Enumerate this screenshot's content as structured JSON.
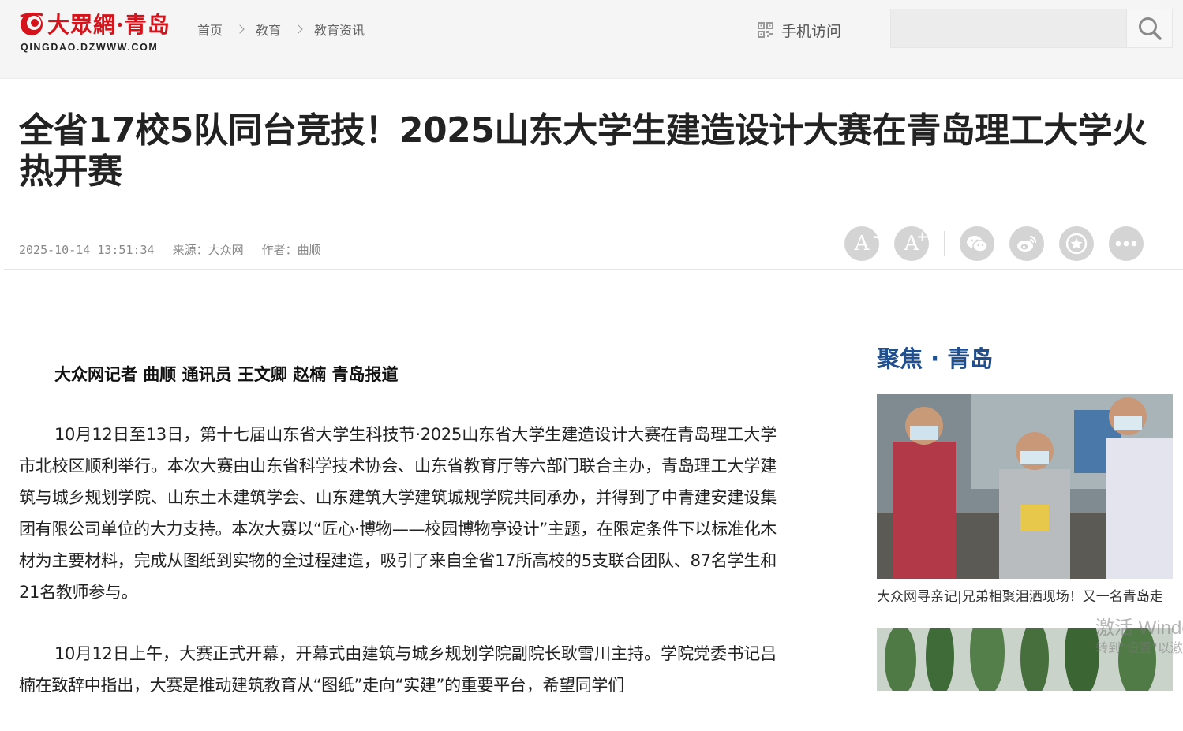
{
  "site": {
    "logo_text": "大眾網·青岛",
    "logo_domain": "QINGDAO.DZWWW.COM"
  },
  "breadcrumb": [
    "首页",
    "教育",
    "教育资讯"
  ],
  "header": {
    "mobile_label": "手机访问",
    "search_placeholder": ""
  },
  "article": {
    "title": "全省17校5队同台竞技！2025山东大学生建造设计大赛在青岛理工大学火热开赛",
    "datetime": "2025-10-14 13:51:34",
    "source": "来源：大众网",
    "author": "作者：曲顺",
    "byline": "大众网记者 曲顺 通讯员 王文卿 赵楠 青岛报道",
    "paragraphs": [
      "10月12日至13日，第十七届山东省大学生科技节·2025山东省大学生建造设计大赛在青岛理工大学市北校区顺利举行。本次大赛由山东省科学技术协会、山东省教育厅等六部门联合主办，青岛理工大学建筑与城乡规划学院、山东土木建筑学会、山东建筑大学建筑城规学院共同承办，并得到了中青建安建设集团有限公司单位的大力支持。本次大赛以“匠心·博物——校园博物亭设计”主题，在限定条件下以标准化木材为主要材料，完成从图纸到实物的全过程建造，吸引了来自全省17所高校的5支联合团队、87名学生和21名教师参与。",
      "10月12日上午，大赛正式开幕，开幕式由建筑与城乡规划学院副院长耿雪川主持。学院党委书记吕楠在致辞中指出，大赛是推动建筑教育从“图纸”走向“实建”的重要平台，希望同学们"
    ]
  },
  "tools": {
    "font_smaller": "A",
    "font_larger": "A",
    "icons": [
      "font-decrease-icon",
      "font-increase-icon",
      "wechat-icon",
      "weibo-icon",
      "favorite-icon",
      "more-icon"
    ]
  },
  "sidebar": {
    "title": "聚焦 · 青岛",
    "items": [
      {
        "caption": "大众网寻亲记|兄弟相聚泪洒现场！又一名青岛走"
      }
    ]
  },
  "os_overlay": {
    "line1": "激活 Windows",
    "line2": "转到\"设置\"以激活"
  },
  "colors": {
    "logo_red": "#d6121a",
    "sidebar_title_blue": "#1f4f8f",
    "tool_gray": "#d4d4d4"
  }
}
